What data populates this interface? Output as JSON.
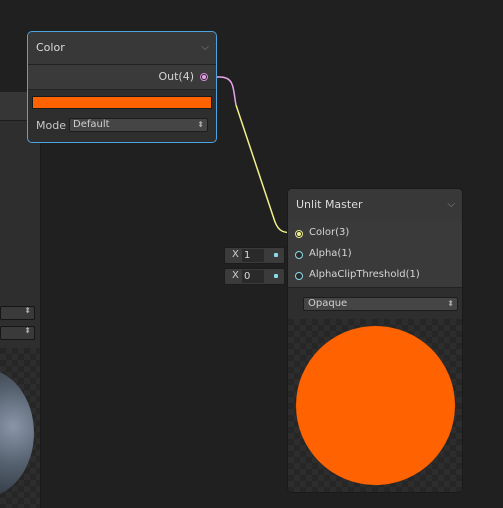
{
  "color_node": {
    "title": "Color",
    "output_label": "Out(4)",
    "color_value": "#ff6200",
    "mode_label": "Mode",
    "mode_value": "Default",
    "accent": "#4ea4e0"
  },
  "master_node": {
    "title": "Unlit Master",
    "inputs": [
      {
        "label": "Color(3)"
      },
      {
        "label": "Alpha(1)"
      },
      {
        "label": "AlphaClipThreshold(1)"
      }
    ],
    "surface_value": "Opaque",
    "preview_color": "#ff6200"
  },
  "input_fields": [
    {
      "axis": "X",
      "value": "1"
    },
    {
      "axis": "X",
      "value": "0"
    }
  ],
  "icons": {
    "collapse": "chevron-down-icon",
    "dropdown": "updown-arrow-icon"
  }
}
